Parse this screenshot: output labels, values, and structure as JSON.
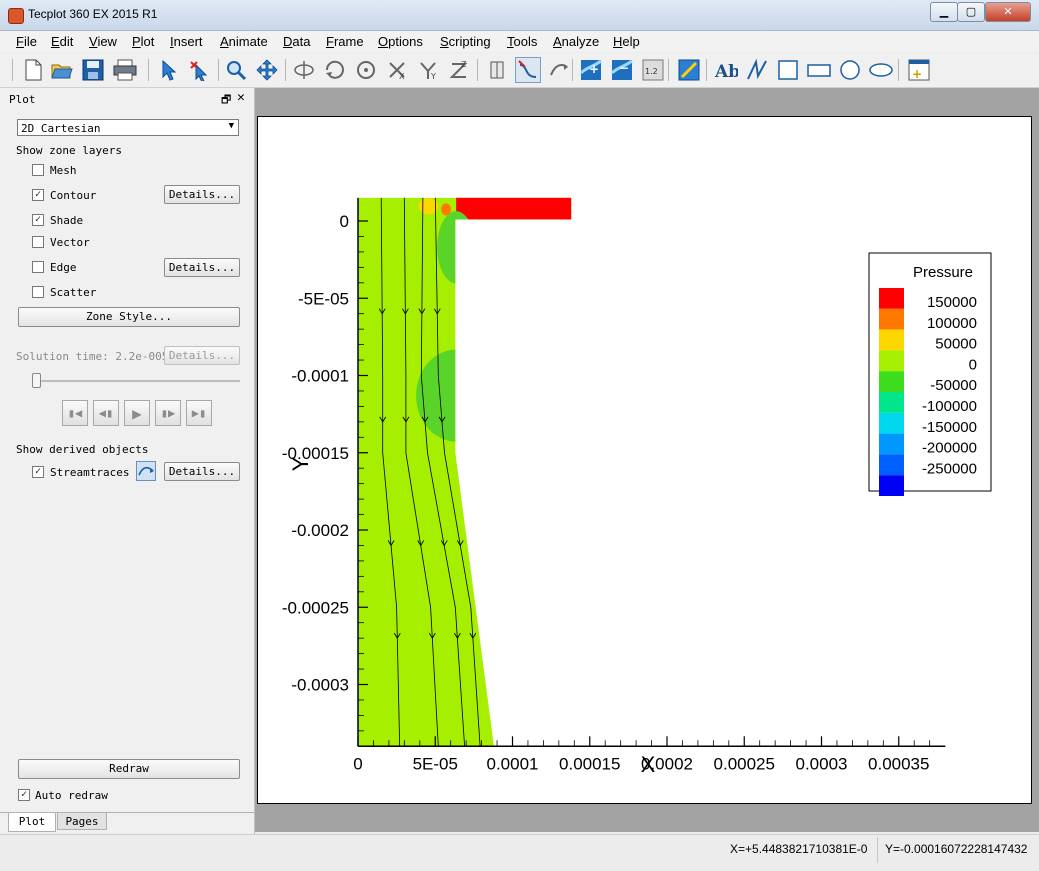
{
  "window": {
    "title": "Tecplot 360 EX 2015 R1",
    "min": "▁",
    "max": "▢",
    "close": "✕"
  },
  "menu": [
    "File",
    "Edit",
    "View",
    "Plot",
    "Insert",
    "Animate",
    "Data",
    "Frame",
    "Options",
    "Scripting",
    "Tools",
    "Analyze",
    "Help"
  ],
  "toolbar_icons": [
    "new-file",
    "open-file",
    "save",
    "print",
    "select",
    "adjustor",
    "zoom",
    "translate",
    "rotate-3d",
    "rollerball",
    "spherical",
    "rotate-x",
    "rotate-y",
    "rotate-z",
    "probe",
    "streamtrace-place",
    "streamtrace-extract",
    "contour-add",
    "contour-remove",
    "contour-level",
    "slice",
    "text",
    "polyline",
    "rectangle",
    "square",
    "circle",
    "ellipse",
    "add-frame"
  ],
  "panel": {
    "title": "Plot",
    "float": "🗗",
    "close": "✕",
    "plot_type": "2D Cartesian",
    "show_zone_layers": "Show zone layers",
    "layers": [
      {
        "label": "Mesh",
        "checked": false
      },
      {
        "label": "Contour",
        "checked": true,
        "details": "Details..."
      },
      {
        "label": "Shade",
        "checked": true
      },
      {
        "label": "Vector",
        "checked": false
      },
      {
        "label": "Edge",
        "checked": false,
        "details": "Details..."
      },
      {
        "label": "Scatter",
        "checked": false
      }
    ],
    "zone_style": "Zone Style...",
    "solution_time": "Solution time: 2.2e-005",
    "solution_details": "Details...",
    "show_derived": "Show derived objects",
    "streamtraces": {
      "label": "Streamtraces",
      "checked": true,
      "details": "Details..."
    },
    "redraw": "Redraw",
    "auto_redraw": {
      "label": "Auto redraw",
      "checked": true
    },
    "tabs": [
      "Plot",
      "Pages"
    ]
  },
  "chart_data": {
    "type": "contour",
    "xlabel": "X",
    "ylabel": "Y",
    "x_ticks": [
      "0",
      "5E-05",
      "0.0001",
      "0.00015",
      "0.0002",
      "0.00025",
      "0.0003",
      "0.00035"
    ],
    "x_tick_values": [
      0,
      5e-05,
      0.0001,
      0.00015,
      0.0002,
      0.00025,
      0.0003,
      0.00035
    ],
    "y_ticks": [
      "0",
      "-5E-05",
      "-0.0001",
      "-0.00015",
      "-0.0002",
      "-0.00025",
      "-0.0003"
    ],
    "y_tick_values": [
      0,
      -5e-05,
      -0.0001,
      -0.00015,
      -0.0002,
      -0.00025,
      -0.0003
    ],
    "xlim": [
      0,
      0.000375
    ],
    "ylim": [
      -0.00034,
      1.5e-05
    ],
    "domain_outline": [
      [
        0,
        1.5e-05
      ],
      [
        0.000138,
        1.5e-05
      ],
      [
        0.000138,
        1e-06
      ],
      [
        6.3e-05,
        1e-06
      ],
      [
        6.3e-05,
        -0.00015
      ],
      [
        8.8e-05,
        -0.00034
      ],
      [
        0,
        -0.00034
      ]
    ],
    "legend": {
      "title": "Pressure",
      "levels": [
        "150000",
        "100000",
        "50000",
        "0",
        "-50000",
        "-100000",
        "-150000",
        "-200000",
        "-250000"
      ],
      "colors": [
        "#ff0000",
        "#ff7800",
        "#ffd700",
        "#a6ef00",
        "#3ddc1c",
        "#00e58a",
        "#00d8ee",
        "#0097ff",
        "#0060ff",
        "#0000f5"
      ]
    },
    "field_color": "#a6ef00",
    "regions": [
      {
        "level": "150000",
        "color": "#ff0000",
        "desc": "inlet top bar"
      },
      {
        "level": "-50000",
        "color": "#5bd42a",
        "desc": "low pressure pockets"
      },
      {
        "level": "100000",
        "color": "#ffd700",
        "desc": "corner high pressure"
      }
    ],
    "streamtraces": 4
  },
  "status": {
    "x": "X=+5.4483821710381E-0",
    "y": "Y=-0.00016072228147432"
  }
}
